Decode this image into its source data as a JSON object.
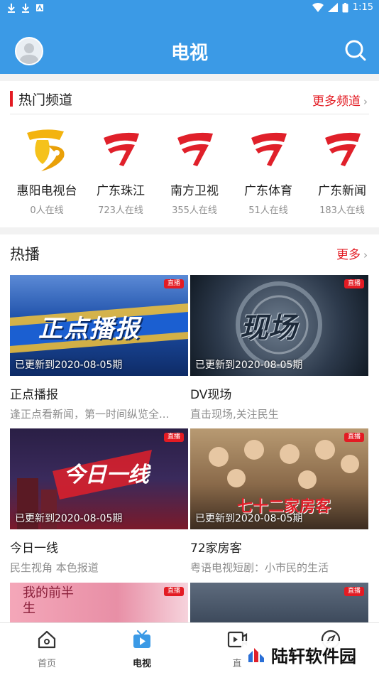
{
  "status_bar": {
    "time": "1:15"
  },
  "header": {
    "title": "电视"
  },
  "channels": {
    "title": "热门频道",
    "more": "更多频道",
    "items": [
      {
        "name": "惠阳电视台",
        "online": "0人在线",
        "logo": "huiyang-logo"
      },
      {
        "name": "广东珠江",
        "online": "723人在线",
        "logo": "gdtv-logo"
      },
      {
        "name": "南方卫视",
        "online": "355人在线",
        "logo": "gdtv-logo"
      },
      {
        "name": "广东体育",
        "online": "51人在线",
        "logo": "gdtv-logo"
      },
      {
        "name": "广东新闻",
        "online": "183人在线",
        "logo": "gdtv-logo"
      }
    ]
  },
  "hot": {
    "title": "热播",
    "more": "更多",
    "live_label": "直播",
    "items": [
      {
        "title": "正点播报",
        "desc": "逢正点看新闻，第一时间纵览全...",
        "update": "已更新到2020-08-05期",
        "thumb_text": "正点播报",
        "color": "#1d4fa8"
      },
      {
        "title": "DV现场",
        "desc": "直击现场,关注民生",
        "update": "已更新到2020-08-05期",
        "thumb_text": "现场",
        "color": "#2d3a4c"
      },
      {
        "title": "今日一线",
        "desc": "民生视角 本色报道",
        "update": "已更新到2020-08-05期",
        "thumb_text": "今日一线",
        "color": "#3a2a5c"
      },
      {
        "title": "72家房客",
        "desc": "粤语电视短剧：小市民的生活",
        "update": "已更新到2020-08-05期",
        "thumb_text": "七十二家房客",
        "color": "#8a6a4a"
      },
      {
        "title": "",
        "desc": "",
        "update": "",
        "thumb_text": "我的前半生",
        "color": "#e88fa6"
      },
      {
        "title": "",
        "desc": "",
        "update": "",
        "thumb_text": "",
        "color": "#3d4a5c"
      }
    ]
  },
  "bottom_nav": {
    "items": [
      {
        "label": "首页",
        "icon": "home-icon"
      },
      {
        "label": "电视",
        "icon": "tv-icon"
      },
      {
        "label": "直",
        "icon": "live-icon"
      },
      {
        "label": "",
        "icon": "discover-icon"
      }
    ]
  },
  "watermark": {
    "text": "陆轩软件园"
  },
  "colors": {
    "brand_blue": "#3b9ae6",
    "accent_red": "#e31b23"
  }
}
